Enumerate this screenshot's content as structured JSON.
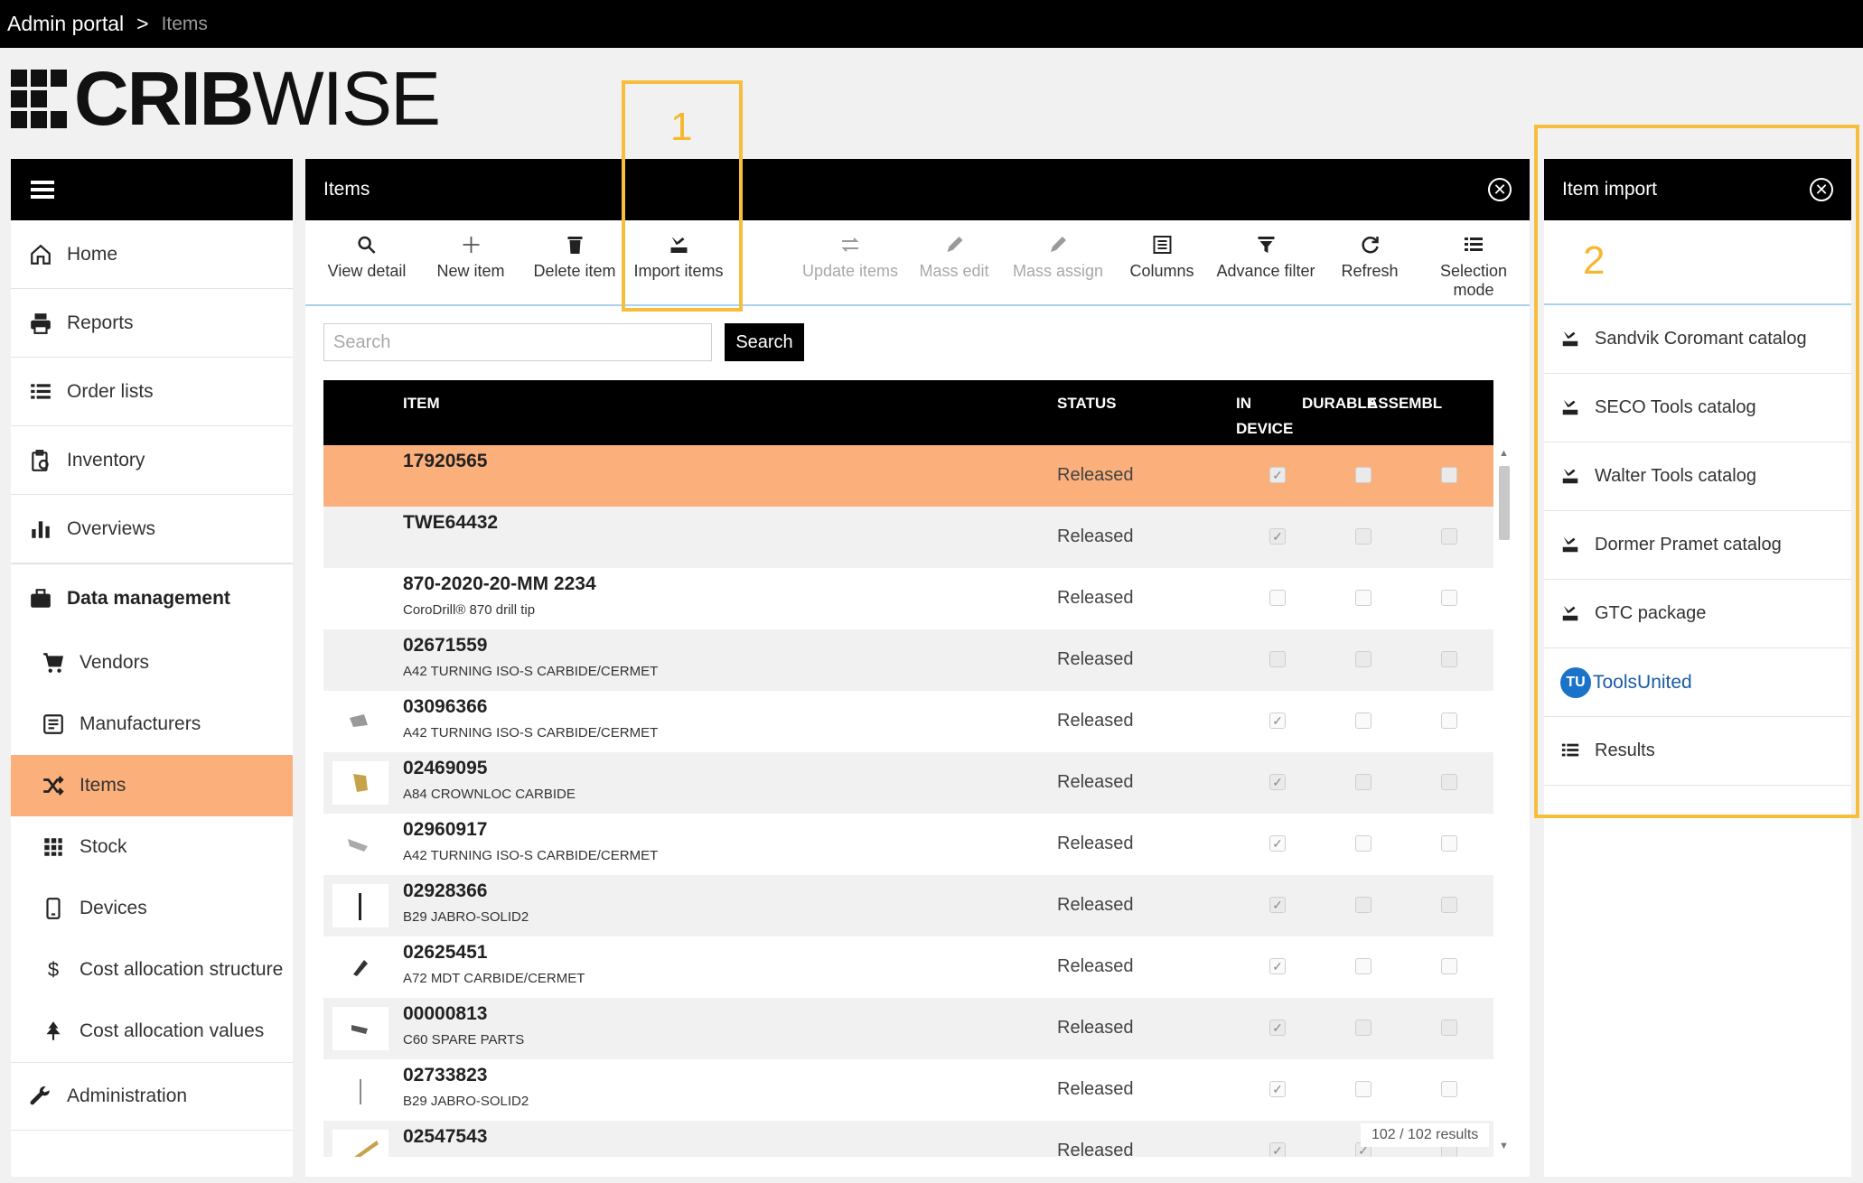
{
  "breadcrumb": {
    "root": "Admin portal",
    "separator": ">",
    "current": "Items"
  },
  "logo": {
    "bold": "CRIB",
    "light": "WISE"
  },
  "sidebar": {
    "items": [
      {
        "label": "Home",
        "icon": "home-icon"
      },
      {
        "label": "Reports",
        "icon": "printer-icon"
      },
      {
        "label": "Order lists",
        "icon": "list-icon"
      },
      {
        "label": "Inventory",
        "icon": "clipboard-icon"
      },
      {
        "label": "Overviews",
        "icon": "bar-chart-icon"
      },
      {
        "label": "Data management",
        "icon": "briefcase-icon"
      },
      {
        "label": "Vendors",
        "icon": "cart-icon"
      },
      {
        "label": "Manufacturers",
        "icon": "factory-icon"
      },
      {
        "label": "Items",
        "icon": "shuffle-icon"
      },
      {
        "label": "Stock",
        "icon": "grid-icon"
      },
      {
        "label": "Devices",
        "icon": "device-icon"
      },
      {
        "label": "Cost allocation structure",
        "icon": "dollar-icon"
      },
      {
        "label": "Cost allocation values",
        "icon": "tree-icon"
      },
      {
        "label": "Administration",
        "icon": "wrench-icon"
      }
    ]
  },
  "main": {
    "title": "Items",
    "toolbar": {
      "view_detail": "View detail",
      "new_item": "New item",
      "delete_item": "Delete item",
      "import_items": "Import items",
      "update_items": "Update items",
      "mass_edit": "Mass edit",
      "mass_assign": "Mass assign",
      "columns": "Columns",
      "advance_filter": "Advance filter",
      "refresh": "Refresh",
      "selection_mode_1": "Selection",
      "selection_mode_2": "mode"
    },
    "search": {
      "placeholder": "Search",
      "button": "Search"
    },
    "table": {
      "columns": {
        "item": "ITEM",
        "status": "STATUS",
        "in_device_1": "IN",
        "in_device_2": "DEVICE",
        "durable": "DURABLE",
        "assembly": "ASSEMBL"
      },
      "rows": [
        {
          "id": "17920565",
          "desc": "",
          "status": "Released",
          "in_device": true,
          "durable": false,
          "assembly": false,
          "selected": true
        },
        {
          "id": "TWE64432",
          "desc": "",
          "status": "Released",
          "in_device": true,
          "durable": false,
          "assembly": false
        },
        {
          "id": "870-2020-20-MM 2234",
          "desc": "CoroDrill® 870 drill tip",
          "status": "Released",
          "in_device": false,
          "durable": false,
          "assembly": false
        },
        {
          "id": "02671559",
          "desc": "A42 TURNING ISO-S CARBIDE/CERMET",
          "status": "Released",
          "in_device": false,
          "durable": false,
          "assembly": false
        },
        {
          "id": "03096366",
          "desc": "A42 TURNING ISO-S CARBIDE/CERMET",
          "status": "Released",
          "in_device": true,
          "durable": false,
          "assembly": false
        },
        {
          "id": "02469095",
          "desc": "A84 CROWNLOC CARBIDE",
          "status": "Released",
          "in_device": true,
          "durable": false,
          "assembly": false
        },
        {
          "id": "02960917",
          "desc": "A42 TURNING ISO-S CARBIDE/CERMET",
          "status": "Released",
          "in_device": true,
          "durable": false,
          "assembly": false
        },
        {
          "id": "02928366",
          "desc": "B29 JABRO-SOLID2",
          "status": "Released",
          "in_device": true,
          "durable": false,
          "assembly": false
        },
        {
          "id": "02625451",
          "desc": "A72 MDT CARBIDE/CERMET",
          "status": "Released",
          "in_device": true,
          "durable": false,
          "assembly": false
        },
        {
          "id": "00000813",
          "desc": "C60 SPARE PARTS",
          "status": "Released",
          "in_device": true,
          "durable": false,
          "assembly": false
        },
        {
          "id": "02733823",
          "desc": "B29 JABRO-SOLID2",
          "status": "Released",
          "in_device": true,
          "durable": false,
          "assembly": false
        },
        {
          "id": "02547543",
          "desc": "",
          "status": "Released",
          "in_device": true,
          "durable": true,
          "assembly": false
        }
      ],
      "results_count": "102 / 102 results"
    }
  },
  "item_import": {
    "title": "Item import",
    "items": [
      {
        "label": "Sandvik Coromant catalog",
        "icon": "import-icon"
      },
      {
        "label": "SECO Tools catalog",
        "icon": "import-icon"
      },
      {
        "label": "Walter Tools catalog",
        "icon": "import-icon"
      },
      {
        "label": "Dormer Pramet catalog",
        "icon": "import-icon"
      },
      {
        "label": "GTC package",
        "icon": "import-icon"
      },
      {
        "label": "ToolsUnited",
        "icon": "toolsunited-logo"
      },
      {
        "label": "Results",
        "icon": "list-icon"
      }
    ]
  },
  "annotations": {
    "one": "1",
    "two": "2"
  },
  "colors": {
    "accent": "#fbb07c",
    "annotation": "#f6be3c",
    "header": "#000000",
    "divider": "#a9d1f0"
  }
}
